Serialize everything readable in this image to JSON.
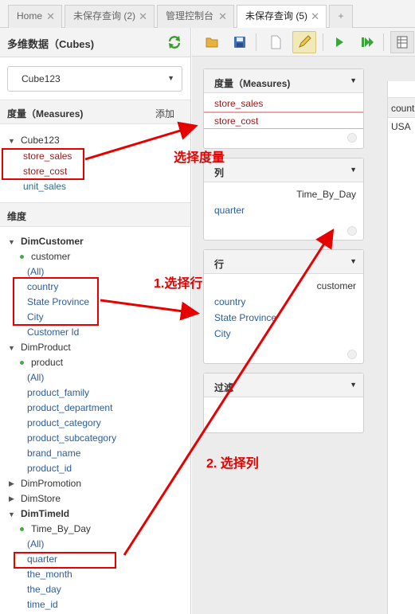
{
  "tabs": [
    {
      "label": "Home"
    },
    {
      "label": "未保存查询 (2)"
    },
    {
      "label": "管理控制台"
    },
    {
      "label": "未保存查询 (5)"
    },
    {
      "label": "+"
    }
  ],
  "left_panel": {
    "title": "多维数据（Cubes)",
    "cube_select_value": "Cube123",
    "measures_section": {
      "title": "度量（Measures)",
      "add_label": "添加"
    },
    "measures_tree": {
      "cube": "Cube123",
      "items": [
        "store_sales",
        "store_cost",
        "unit_sales"
      ]
    },
    "dimensions_section": {
      "title": "维度"
    },
    "dimensions": {
      "customer": {
        "name": "DimCustomer",
        "hierarchy": "customer",
        "levels": [
          "(All)",
          "country",
          "State Province",
          "City",
          "Customer Id"
        ]
      },
      "product": {
        "name": "DimProduct",
        "hierarchy": "product",
        "levels": [
          "(All)",
          "product_family",
          "product_department",
          "product_category",
          "product_subcategory",
          "brand_name",
          "product_id"
        ]
      },
      "promotion": {
        "name": "DimPromotion"
      },
      "store": {
        "name": "DimStore"
      },
      "time": {
        "name": "DimTimeId",
        "hierarchy": "Time_By_Day",
        "levels": [
          "(All)",
          "quarter",
          "the_month",
          "the_day",
          "time_id"
        ]
      }
    }
  },
  "toolbar": {
    "icons": [
      "folder-open-icon",
      "save-icon",
      "new-document-icon",
      "edit-pencil-icon",
      "run-query-icon",
      "run-step-icon",
      "grid-view-icon"
    ]
  },
  "query_boxes": {
    "measures": {
      "title": "度量（Measures)",
      "items": [
        "store_sales",
        "store_cost"
      ]
    },
    "columns": {
      "title": "列",
      "hierarchy": "Time_By_Day",
      "items": [
        "quarter"
      ]
    },
    "rows": {
      "title": "行",
      "hierarchy": "customer",
      "items": [
        "country",
        "State Province",
        "City"
      ]
    },
    "filter": {
      "title": "过滤"
    }
  },
  "result": {
    "header": "country",
    "cell": "USA"
  },
  "annotations": {
    "select_measures": "选择度量",
    "select_rows": "1.选择行",
    "select_columns": "2. 选择列"
  },
  "colors": {
    "annotation_red": "#e60000",
    "measure_text": "#9a1a1a",
    "level_text": "#2a5d9a"
  }
}
